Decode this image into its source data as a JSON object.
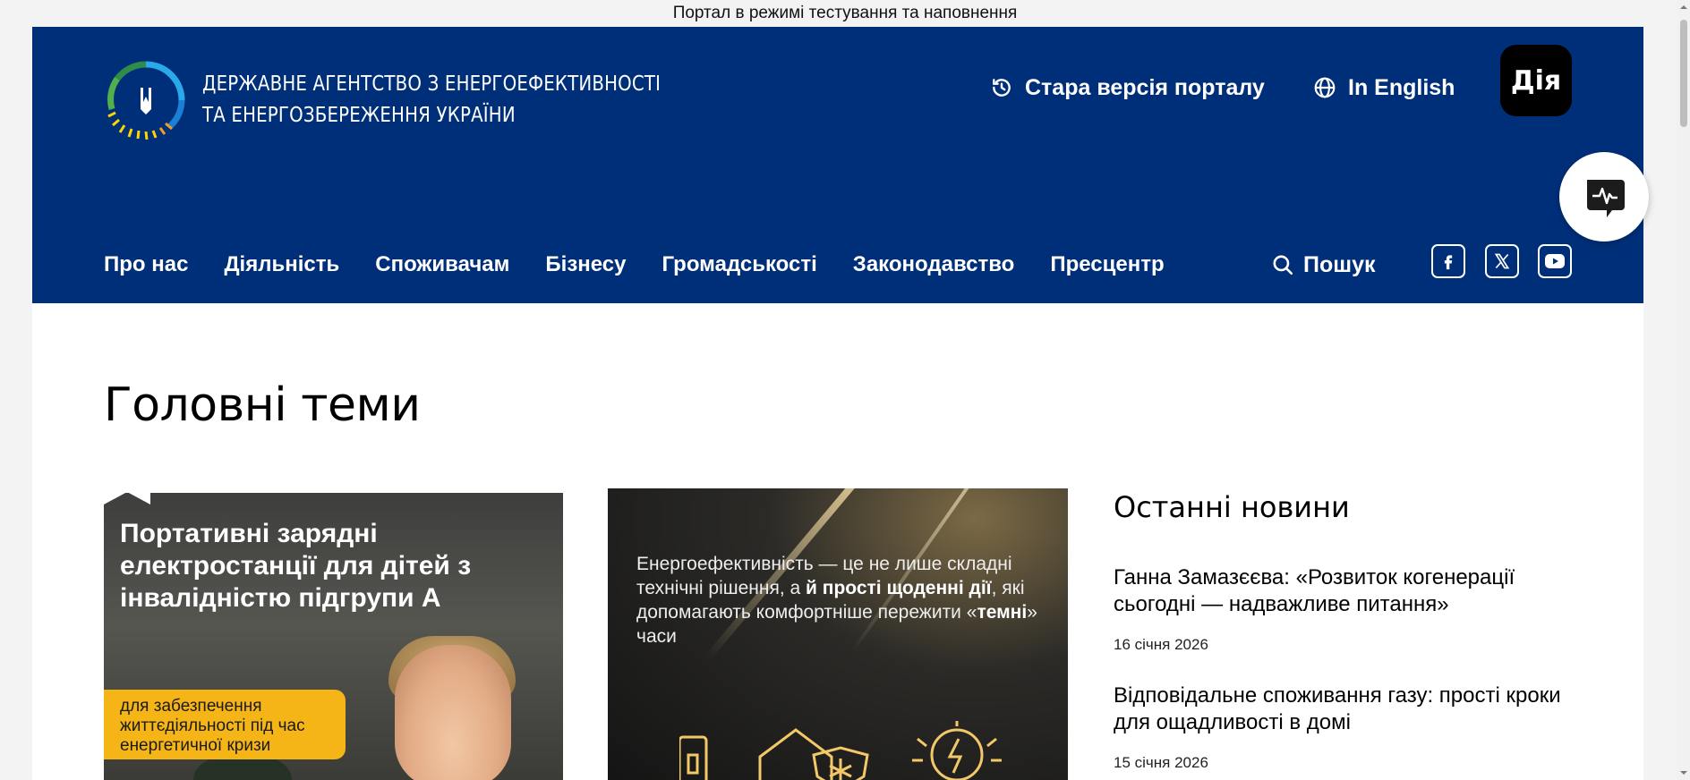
{
  "banner": "Портал в режимі тестування та наповнення",
  "header": {
    "agency_line1": "Державне агентство з енергоефективності",
    "agency_line2": "та енергозбереження України",
    "old_version": "Стара версія порталу",
    "english": "In English",
    "diia": "Дія"
  },
  "nav": {
    "items": [
      "Про нас",
      "Діяльність",
      "Споживачам",
      "Бізнесу",
      "Громадськості",
      "Законодавство",
      "Пресцентр"
    ],
    "search": "Пошук"
  },
  "main": {
    "heading": "Головні теми",
    "card1": {
      "title": "Портативні зарядні електростанції для дітей з інвалідністю підгрупи А",
      "note": "для забезпечення життєдіяльності під час енергетичної кризи"
    },
    "card2": {
      "text_a": "Енергоефективність — це не лише складні технічні рішення, а ",
      "text_b": "й прості щоденні дії",
      "text_c": ", які допомагають комфортніше пережити «",
      "text_d": "темні",
      "text_e": "» часи"
    }
  },
  "news": {
    "heading": "Останні новини",
    "items": [
      {
        "title": "Ганна Замазєєва: «Розвиток когенерації сьогодні — надважливе питання»",
        "date": "16 січня 2026"
      },
      {
        "title": "Відповідальне споживання газу: прості кроки для ощадливості в домі",
        "date": "15 січня 2026"
      }
    ]
  },
  "colors": {
    "header_bg": "#002f7a",
    "pill": "#f5b516",
    "page_bg": "#ffffff"
  },
  "icons": [
    "history-icon",
    "globe-icon",
    "search-icon",
    "facebook-icon",
    "x-icon",
    "youtube-icon",
    "feedback-icon"
  ]
}
